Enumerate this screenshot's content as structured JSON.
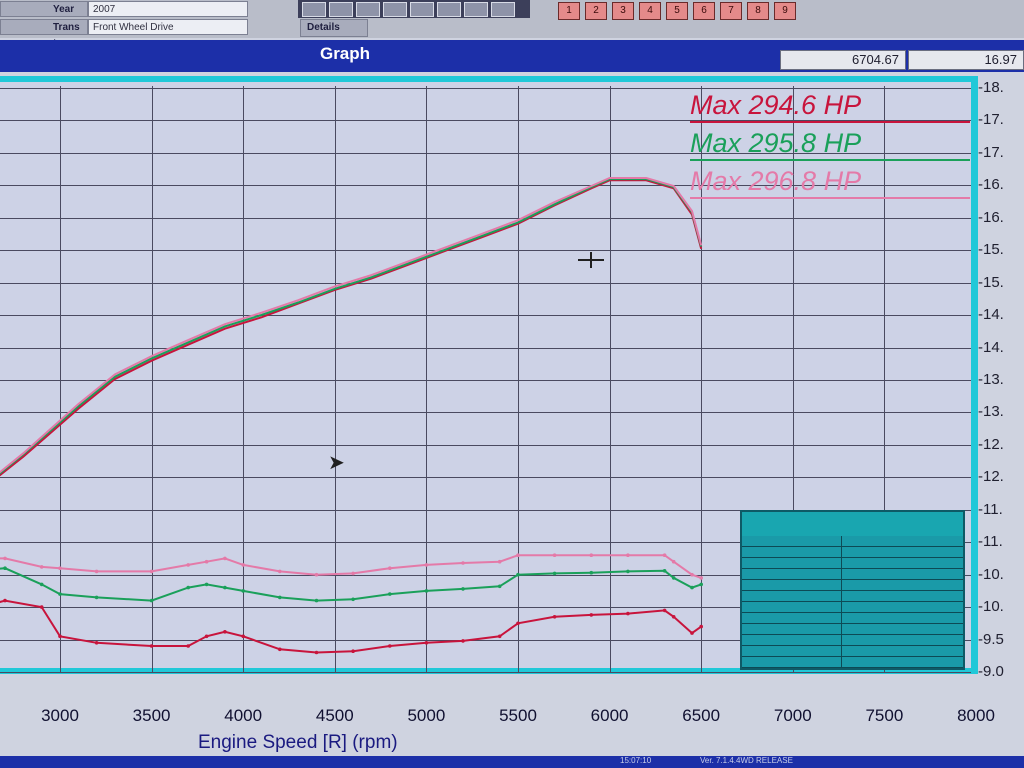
{
  "header": {
    "year_label": "Year",
    "year_value": "2007",
    "trans_label": "Trans type",
    "trans_value": "Front Wheel Drive",
    "details_label": "Details",
    "number_buttons": [
      "1",
      "2",
      "3",
      "4",
      "5",
      "6",
      "7",
      "8",
      "9"
    ]
  },
  "titlebar": {
    "title": "Graph",
    "readout_1": "6704.67",
    "readout_2": "16.97"
  },
  "status": {
    "left_text": "15:07:10",
    "version_text": "Ver. 7.1.4.4WD RELEASE"
  },
  "colors": {
    "series_red": "#c8143c",
    "series_green": "#1aa05a",
    "series_pink": "#e47aa8",
    "grid": "#4a4a60",
    "plot_bg": "#cdd2e6"
  },
  "chart_data": {
    "type": "line",
    "title": "",
    "xlabel": "Engine Speed [R] (rpm)",
    "ylabel": "",
    "xlim": [
      2500,
      8000
    ],
    "x_ticks": [
      "3000",
      "3500",
      "4000",
      "4500",
      "5000",
      "5500",
      "6000",
      "6500",
      "7000",
      "7500",
      "8000"
    ],
    "y_tick_labels": [
      "18.",
      "17.",
      "17.",
      "16.",
      "16.",
      "15.",
      "15.",
      "14.",
      "14.",
      "13.",
      "13.",
      "12.",
      "12.",
      "11.",
      "11.",
      "10.",
      "10.",
      "9.5",
      "9.0"
    ],
    "legend": [
      {
        "label": "Max 294.6 HP",
        "color": "#c8143c"
      },
      {
        "label": "Max 295.8 HP",
        "color": "#1aa05a"
      },
      {
        "label": "Max 296.8 HP",
        "color": "#e47aa8"
      }
    ],
    "power_series": [
      {
        "name": "Max 294.6 HP",
        "color": "#c8143c",
        "x": [
          2500,
          2800,
          3100,
          3300,
          3500,
          3700,
          3900,
          4100,
          4300,
          4500,
          4700,
          4900,
          5100,
          5300,
          5500,
          5700,
          5900,
          6000,
          6200,
          6350,
          6450,
          6500
        ],
        "y": [
          130,
          168,
          210,
          236,
          252,
          266,
          280,
          290,
          302,
          314,
          324,
          336,
          348,
          360,
          372,
          388,
          403,
          410,
          410,
          403,
          380,
          350
        ]
      },
      {
        "name": "Max 295.8 HP",
        "color": "#1aa05a",
        "x": [
          2500,
          2800,
          3100,
          3300,
          3500,
          3700,
          3900,
          4100,
          4300,
          4500,
          4700,
          4900,
          5100,
          5300,
          5500,
          5700,
          5900,
          6000,
          6200,
          6350,
          6450,
          6500
        ],
        "y": [
          131,
          170,
          212,
          238,
          254,
          268,
          282,
          292,
          303,
          315,
          325,
          337,
          349,
          361,
          373,
          389,
          404,
          411,
          411,
          404,
          382,
          352
        ]
      },
      {
        "name": "Max 296.8 HP",
        "color": "#e47aa8",
        "x": [
          2500,
          2800,
          3100,
          3300,
          3500,
          3700,
          3900,
          4100,
          4300,
          4500,
          4700,
          4900,
          5100,
          5300,
          5500,
          5700,
          5900,
          6000,
          6200,
          6350,
          6450,
          6500
        ],
        "y": [
          132,
          171,
          214,
          240,
          256,
          270,
          284,
          294,
          305,
          317,
          327,
          339,
          351,
          363,
          375,
          391,
          405,
          412,
          412,
          405,
          383,
          353
        ]
      }
    ],
    "torque_series": [
      {
        "name": "Max 294.6 HP",
        "color": "#c8143c",
        "x": [
          2500,
          2700,
          2900,
          3000,
          3200,
          3500,
          3700,
          3800,
          3900,
          4000,
          4200,
          4400,
          4600,
          4800,
          5000,
          5200,
          5400,
          5500,
          5700,
          5900,
          6100,
          6300,
          6350,
          6450,
          6500
        ],
        "y": [
          9.95,
          10.1,
          10.0,
          9.55,
          9.45,
          9.4,
          9.4,
          9.55,
          9.62,
          9.55,
          9.35,
          9.3,
          9.32,
          9.4,
          9.45,
          9.48,
          9.55,
          9.75,
          9.85,
          9.88,
          9.9,
          9.95,
          9.85,
          9.6,
          9.7
        ]
      },
      {
        "name": "Max 295.8 HP",
        "color": "#1aa05a",
        "x": [
          2500,
          2700,
          2900,
          3000,
          3200,
          3500,
          3700,
          3800,
          3900,
          4000,
          4200,
          4400,
          4600,
          4800,
          5000,
          5200,
          5400,
          5500,
          5700,
          5900,
          6100,
          6300,
          6350,
          6450,
          6500
        ],
        "y": [
          10.55,
          10.6,
          10.35,
          10.2,
          10.15,
          10.1,
          10.3,
          10.35,
          10.3,
          10.25,
          10.15,
          10.1,
          10.12,
          10.2,
          10.25,
          10.28,
          10.32,
          10.5,
          10.52,
          10.53,
          10.55,
          10.56,
          10.45,
          10.3,
          10.35
        ]
      },
      {
        "name": "Max 296.8 HP",
        "color": "#e47aa8",
        "x": [
          2500,
          2700,
          2900,
          3000,
          3200,
          3500,
          3700,
          3800,
          3900,
          4000,
          4200,
          4400,
          4600,
          4800,
          5000,
          5200,
          5400,
          5500,
          5700,
          5900,
          6100,
          6300,
          6350,
          6450,
          6500
        ],
        "y": [
          10.75,
          10.75,
          10.62,
          10.6,
          10.55,
          10.55,
          10.65,
          10.7,
          10.75,
          10.65,
          10.55,
          10.5,
          10.52,
          10.6,
          10.65,
          10.68,
          10.7,
          10.8,
          10.8,
          10.8,
          10.8,
          10.8,
          10.7,
          10.5,
          10.45
        ]
      }
    ]
  }
}
